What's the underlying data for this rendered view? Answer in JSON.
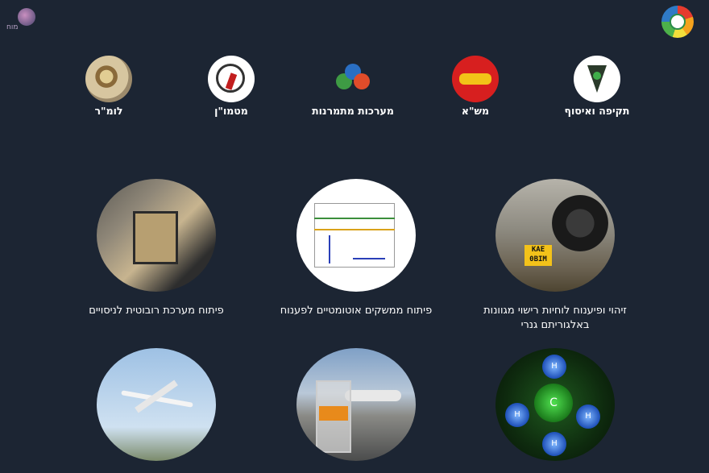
{
  "header": {
    "left_logo_text": "מוח",
    "right_logo": "colorful-circle-logo"
  },
  "categories": [
    {
      "label": "תקיפה ואיסוף",
      "icon": "takifa-logo"
    },
    {
      "label": "מש\"א",
      "icon": "msha-logo"
    },
    {
      "label": "מערכות מתמרנות",
      "icon": "marachot-logo"
    },
    {
      "label": "מטמו\"ן",
      "icon": "matmon-logo"
    },
    {
      "label": "לומ\"ר",
      "icon": "lomar-logo"
    }
  ],
  "projects": [
    {
      "label": "זיהוי ופיענוח לוחיות רישוי מגוונות באלגוריתם גנרי",
      "image": "car-license-plate"
    },
    {
      "label": "פיתוח ממשקים אוטומטיים לפענוח",
      "image": "graph-plot"
    },
    {
      "label": "פיתוח מערכת רובוטית לניסויים",
      "image": "robot-system"
    },
    {
      "label": "",
      "image": "molecule"
    },
    {
      "label": "",
      "image": "airport-sample"
    },
    {
      "label": "",
      "image": "uav-plane"
    }
  ],
  "plate_text": "KAE 0BIM",
  "molecule_labels": {
    "center": "C",
    "atom": "H"
  }
}
